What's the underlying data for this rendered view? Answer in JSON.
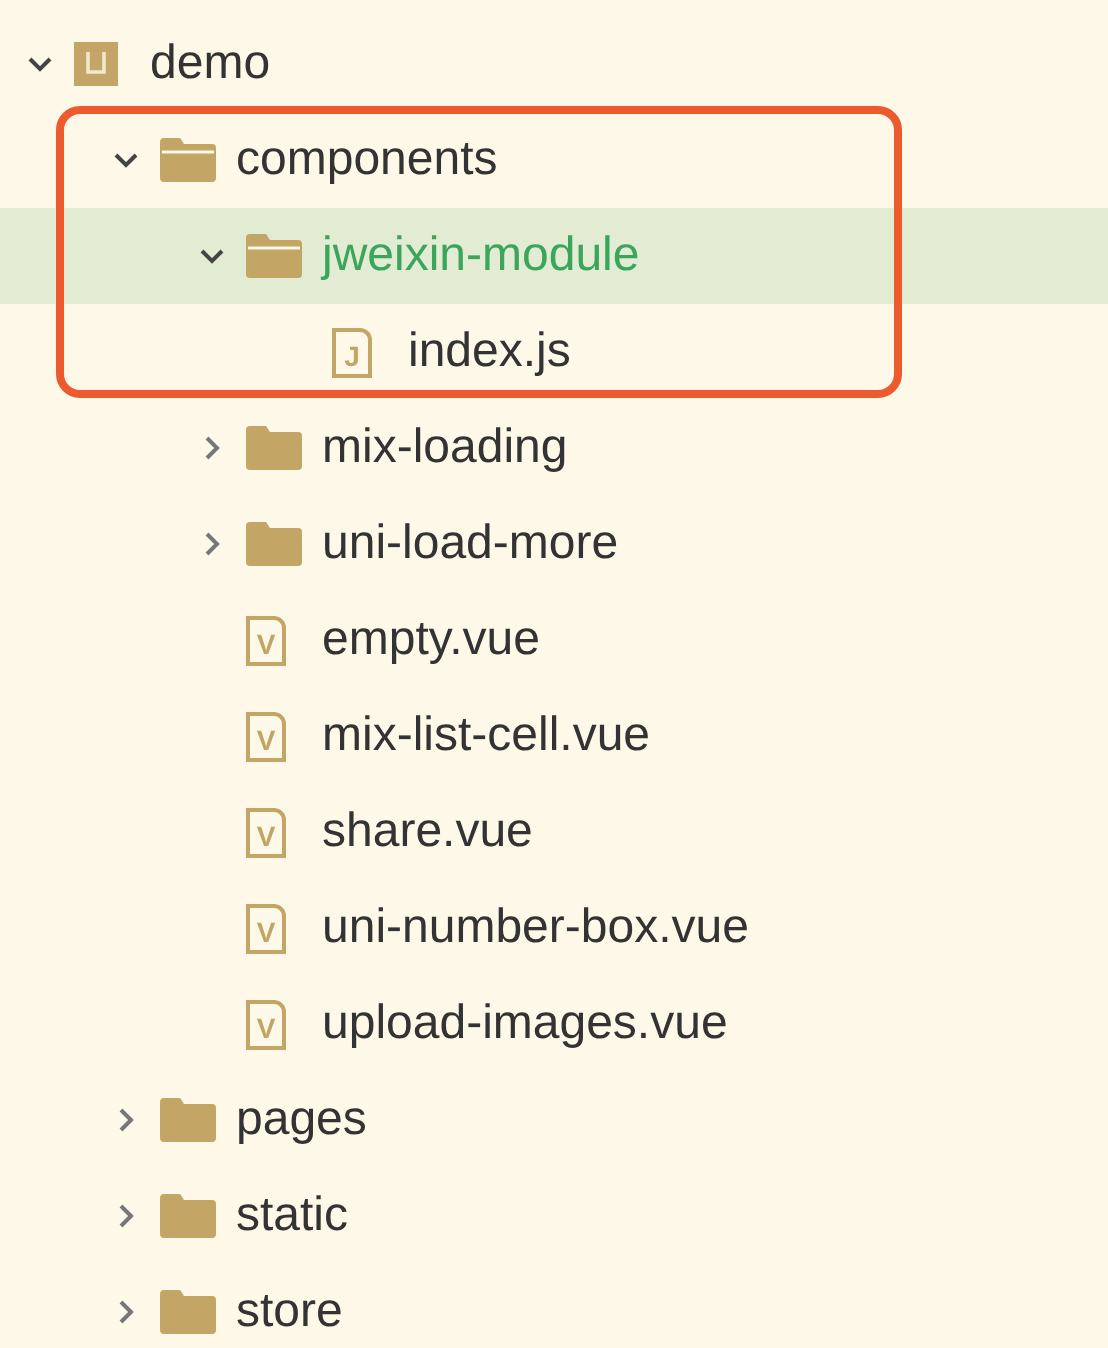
{
  "tree": [
    {
      "kind": "project",
      "name": "demo",
      "expanded": true,
      "selected": false,
      "annotated": false,
      "children": [
        {
          "kind": "folder",
          "name": "components",
          "expanded": true,
          "selected": false,
          "annotated": true,
          "children": [
            {
              "kind": "folder",
              "name": "jweixin-module",
              "expanded": true,
              "selected": true,
              "annotated": true,
              "children": [
                {
                  "kind": "file",
                  "name": "index.js",
                  "badge": "J",
                  "selected": false,
                  "annotated": true
                }
              ]
            },
            {
              "kind": "folder",
              "name": "mix-loading",
              "expanded": false,
              "selected": false,
              "annotated": false
            },
            {
              "kind": "folder",
              "name": "uni-load-more",
              "expanded": false,
              "selected": false,
              "annotated": false
            },
            {
              "kind": "file",
              "name": "empty.vue",
              "badge": "V",
              "selected": false,
              "annotated": false
            },
            {
              "kind": "file",
              "name": "mix-list-cell.vue",
              "badge": "V",
              "selected": false,
              "annotated": false
            },
            {
              "kind": "file",
              "name": "share.vue",
              "badge": "V",
              "selected": false,
              "annotated": false
            },
            {
              "kind": "file",
              "name": "uni-number-box.vue",
              "badge": "V",
              "selected": false,
              "annotated": false
            },
            {
              "kind": "file",
              "name": "upload-images.vue",
              "badge": "V",
              "selected": false,
              "annotated": false
            }
          ]
        },
        {
          "kind": "folder",
          "name": "pages",
          "expanded": false,
          "selected": false,
          "annotated": false
        },
        {
          "kind": "folder",
          "name": "static",
          "expanded": false,
          "selected": false,
          "annotated": false
        },
        {
          "kind": "folder",
          "name": "store",
          "expanded": false,
          "selected": false,
          "annotated": false
        }
      ]
    }
  ]
}
